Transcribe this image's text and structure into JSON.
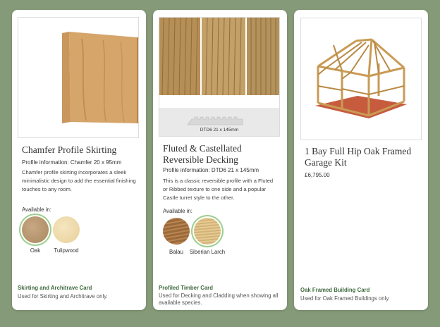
{
  "cards": [
    {
      "title": "Chamfer Profile Skirting",
      "profile": "Profile information: Chamfer 20 x 95mm",
      "description": "Chamfer profile skirting incorporates a sleek minimalistic design to add the essential finishing touches to any room.",
      "available_label": "Available in:",
      "swatches": [
        {
          "label": "Oak",
          "color": "#b8976f",
          "selected": true
        },
        {
          "label": "Tulipwood",
          "color": "#efdcad",
          "selected": false
        }
      ],
      "card_name": "Skirting and Architrave Card",
      "card_note": "Used for Skirting and Architrave only."
    },
    {
      "title": "Fluted & Castellated Reversible Decking",
      "profile": "Profile information: DTD6 21 x 145mm",
      "description": "This is a classic reversible profile with a Fluted or Ribbed texture to one side and a popular Castle turret style to the other.",
      "image_caption": "DTD6 21 x 145mm",
      "available_label": "Available in:",
      "swatches": [
        {
          "label": "Balau",
          "color": "#9b6a3a",
          "selected": false
        },
        {
          "label": "Siberian Larch",
          "color": "#d9bb80",
          "selected": true
        }
      ],
      "card_name": "Profiled Timber Card",
      "card_note": "Used for Decking and Cladding when showing all available species."
    },
    {
      "title": "1 Bay Full Hip Oak Framed Garage Kit",
      "price": "£6,795.00",
      "card_name": "Oak Framed Building Card",
      "card_note": "Used for Oak Framed Buildings only."
    }
  ],
  "colors": {
    "background": "#859a78",
    "accent": "#3f6a3f",
    "selected_ring": "#9dcf8f"
  }
}
